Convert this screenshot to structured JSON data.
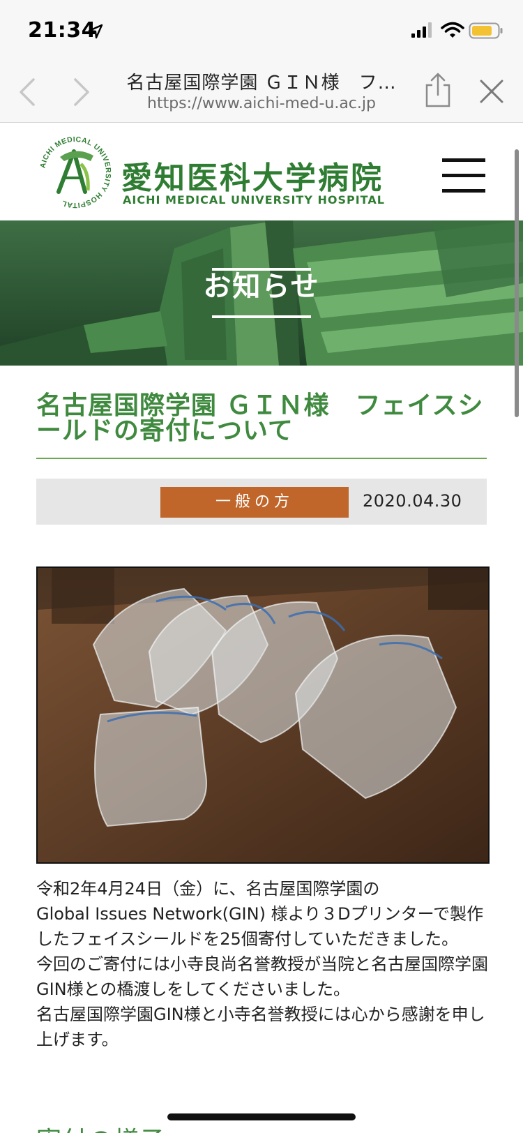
{
  "status_bar": {
    "time": "21:34"
  },
  "browser": {
    "page_title": "名古屋国際学園 ＧＩＮ様　フ…",
    "url": "https://www.aichi-med-u.ac.jp"
  },
  "site": {
    "logo_emblem_text": "AICHI MEDICAL UNIVERSITY HOSPITAL",
    "name_jp": "愛知医科大学病院",
    "name_en": "AICHI MEDICAL UNIVERSITY HOSPITAL"
  },
  "hero": {
    "title": "お知らせ"
  },
  "article": {
    "title": "名古屋国際学園 ＧＩＮ様　フェイスシールドの寄付について",
    "category": "一般の方",
    "date": "2020.04.30",
    "paragraphs": [
      "令和2年4月24日（金）に、名古屋国際学園の",
      "Global Issues Network(GIN) 様より３Dプリンターで製作したフェイスシールドを25個寄付していただきました。",
      "今回のご寄付には小寺良尚名誉教授が当院と名古屋国際学園GIN様との橋渡しをしてくださいました。",
      "名古屋国際学園GIN様と小寺名誉教授には心から感謝を申し上げます。"
    ],
    "next_heading": "寄付の様子"
  }
}
